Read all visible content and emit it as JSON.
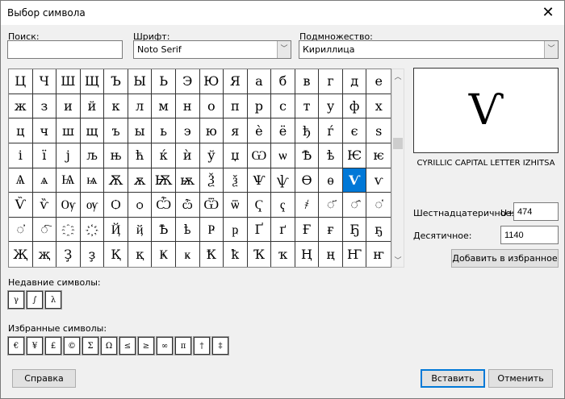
{
  "title": "Выбор символа",
  "search": {
    "label": "Поиск:",
    "value": ""
  },
  "font": {
    "label": "Шрифт:",
    "value": "Noto Serif"
  },
  "subset": {
    "label": "Подмножество:",
    "value": "Кириллица"
  },
  "grid": {
    "selected_index": 78,
    "chars": [
      "Ц",
      "Ч",
      "Ш",
      "Щ",
      "Ъ",
      "Ы",
      "Ь",
      "Э",
      "Ю",
      "Я",
      "а",
      "б",
      "в",
      "г",
      "д",
      "е",
      "ж",
      "з",
      "и",
      "й",
      "к",
      "л",
      "м",
      "н",
      "о",
      "п",
      "р",
      "с",
      "т",
      "у",
      "ф",
      "х",
      "ц",
      "ч",
      "ш",
      "щ",
      "ъ",
      "ы",
      "ь",
      "э",
      "ю",
      "я",
      "ѐ",
      "ё",
      "ђ",
      "ѓ",
      "є",
      "ѕ",
      "і",
      "ї",
      "ј",
      "љ",
      "њ",
      "ћ",
      "ќ",
      "ѝ",
      "ў",
      "џ",
      "Ѡ",
      "ѡ",
      "Ѣ",
      "ѣ",
      "Ѥ",
      "ѥ",
      "Ѧ",
      "ѧ",
      "Ѩ",
      "ѩ",
      "Ѫ",
      "ѫ",
      "Ѭ",
      "ѭ",
      "Ѯ",
      "ѯ",
      "Ѱ",
      "ѱ",
      "Ѳ",
      "ѳ",
      "Ѵ",
      "ѵ",
      "Ѷ",
      "ѷ",
      "Ѹ",
      "ѹ",
      "Ѻ",
      "ѻ",
      "Ѽ",
      "ѽ",
      "Ѿ",
      "ѿ",
      "Ҁ",
      "ҁ",
      "҂",
      "◌҃",
      "◌҄",
      "◌҅",
      "◌҆",
      "◌҇",
      "҈",
      "҉",
      "Ҋ",
      "ҋ",
      "Ҍ",
      "ҍ",
      "Ҏ",
      "ҏ",
      "Ґ",
      "ґ",
      "Ғ",
      "ғ",
      "Ҕ",
      "ҕ",
      "Җ",
      "җ",
      "Ҙ",
      "ҙ",
      "Қ",
      "қ",
      "Ҝ",
      "ҝ",
      "Ҟ",
      "ҟ",
      "Ҡ",
      "ҡ",
      "Ң",
      "ң",
      "Ҥ",
      "ҥ"
    ]
  },
  "preview": {
    "char": "Ѵ",
    "name": "CYRILLIC CAPITAL LETTER IZHITSA"
  },
  "hex": {
    "label": "Шестнадцатеричное:",
    "prefix": "U+",
    "value": "474"
  },
  "decimal": {
    "label": "Десятичное:",
    "value": "1140"
  },
  "add_favorite_label": "Добавить в избранное",
  "recent": {
    "label": "Недавние символы:",
    "chars": [
      "γ",
      "∫",
      "λ"
    ]
  },
  "favorites": {
    "label": "Избранные символы:",
    "chars": [
      "€",
      "¥",
      "£",
      "©",
      "Σ",
      "Ω",
      "≤",
      "≥",
      "∞",
      "π",
      "†",
      "‡"
    ]
  },
  "buttons": {
    "help": "Справка",
    "insert": "Вставить",
    "cancel": "Отменить"
  }
}
